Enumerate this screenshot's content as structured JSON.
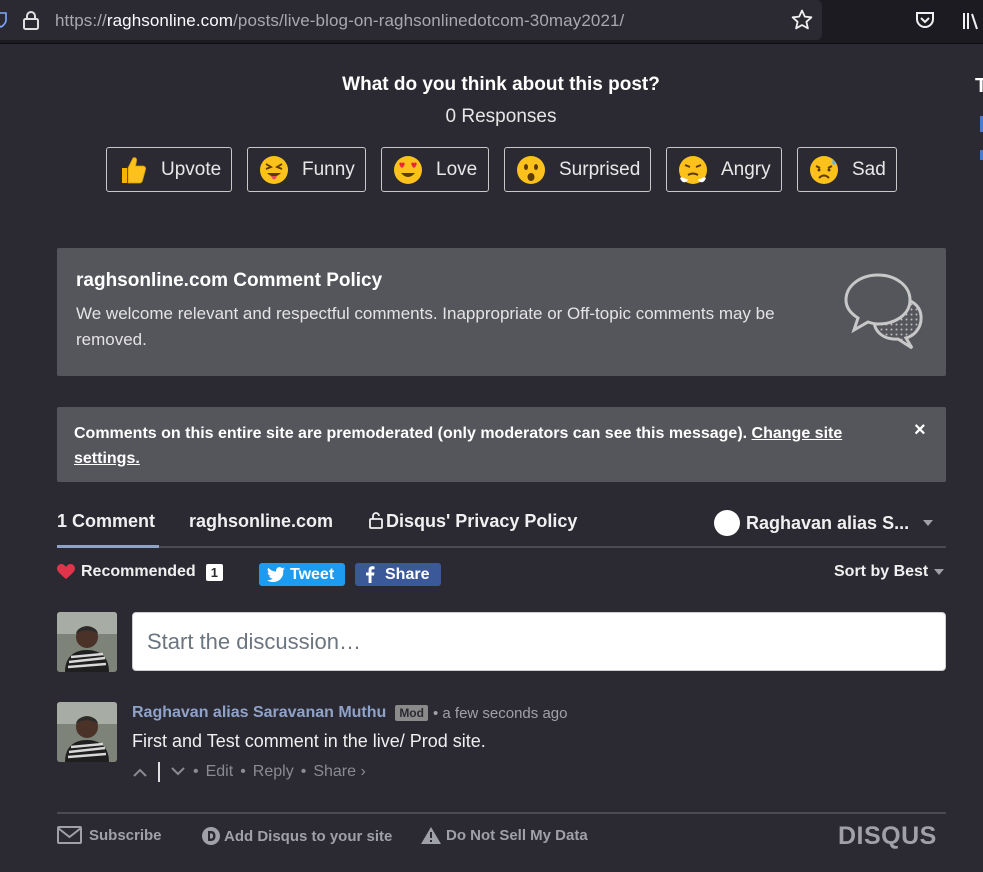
{
  "browser": {
    "url_prefix": "https://",
    "url_host": "raghsonline.com",
    "url_path": "/posts/live-blog-on-raghsonlinedotcom-30may2021/"
  },
  "reactions": {
    "title": "What do you think about this post?",
    "responses": "0 Responses",
    "items": [
      {
        "label": "Upvote",
        "icon": "thumbs-up-emoji"
      },
      {
        "label": "Funny",
        "icon": "squinting-tongue-emoji"
      },
      {
        "label": "Love",
        "icon": "heart-eyes-emoji"
      },
      {
        "label": "Surprised",
        "icon": "astonished-emoji"
      },
      {
        "label": "Angry",
        "icon": "steam-nose-emoji"
      },
      {
        "label": "Sad",
        "icon": "sad-sweat-emoji"
      }
    ]
  },
  "policy": {
    "title": "raghsonline.com Comment Policy",
    "text": "We welcome relevant and respectful comments. Inappropriate or Off-topic comments may be removed."
  },
  "premod": {
    "text": "Comments on this entire site are premoderated (only moderators can see this message). ",
    "link": "Change site settings.",
    "close": "×"
  },
  "nav": {
    "comments_tab": "1 Comment",
    "site_tab": "raghsonline.com",
    "privacy_tab": "Disqus' Privacy Policy",
    "user_menu": "Raghavan alias S..."
  },
  "toolbar": {
    "recommended": "Recommended",
    "recommended_count": "1",
    "tweet": "Tweet",
    "share": "Share",
    "sort": "Sort by Best"
  },
  "composer": {
    "placeholder": "Start the discussion…"
  },
  "comment": {
    "author": "Raghavan alias Saravanan Muthu",
    "badge": "Mod",
    "meta": "• a few seconds ago",
    "body": "First and Test comment in the live/ Prod site.",
    "edit": "Edit",
    "reply": "Reply",
    "share": "Share ›"
  },
  "footer": {
    "subscribe": "Subscribe",
    "add_disqus": "Add Disqus to your site",
    "do_not_sell": "Do Not Sell My Data",
    "logo": "DISQUS"
  },
  "edge": {
    "fragment": "T"
  },
  "colors": {
    "background": "#2b2a33",
    "panel": "#55555c",
    "link_accent": "#8fa3c9",
    "twitter": "#1d9bf0",
    "facebook": "#3b5998",
    "heart": "#e0344b"
  }
}
